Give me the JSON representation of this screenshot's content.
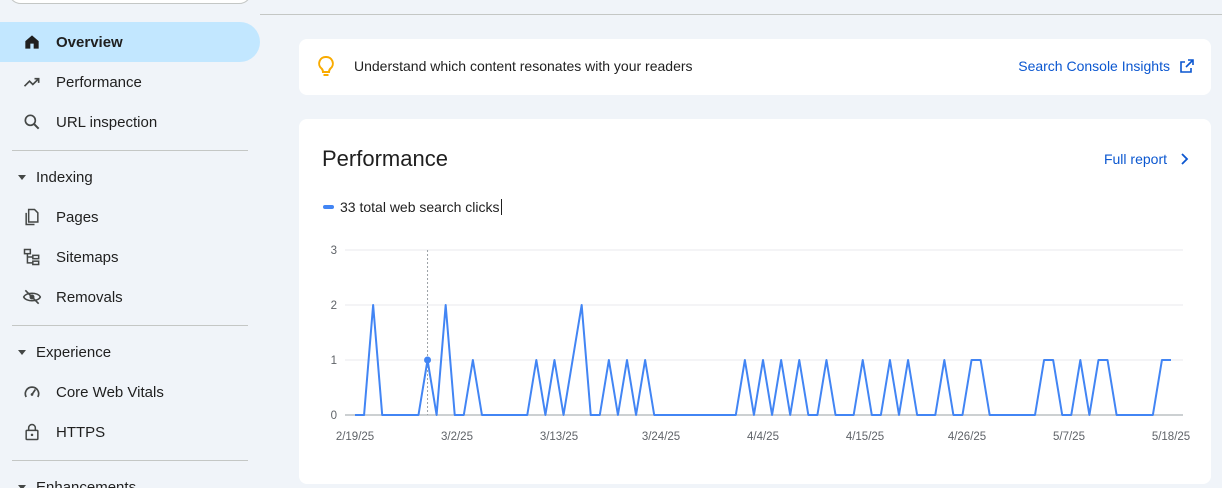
{
  "sidebar": {
    "items": [
      {
        "label": "Overview",
        "icon": "home-icon",
        "active": true
      },
      {
        "label": "Performance",
        "icon": "trending-up-icon"
      },
      {
        "label": "URL inspection",
        "icon": "search-icon"
      }
    ],
    "sections": [
      {
        "label": "Indexing",
        "items": [
          {
            "label": "Pages",
            "icon": "pages-icon"
          },
          {
            "label": "Sitemaps",
            "icon": "sitemap-icon"
          },
          {
            "label": "Removals",
            "icon": "eye-off-icon"
          }
        ]
      },
      {
        "label": "Experience",
        "items": [
          {
            "label": "Core Web Vitals",
            "icon": "speed-icon"
          },
          {
            "label": "HTTPS",
            "icon": "lock-icon"
          }
        ]
      },
      {
        "label": "Enhancements",
        "items": []
      }
    ]
  },
  "insights": {
    "text": "Understand which content resonates with your readers",
    "link_label": "Search Console Insights",
    "icon": "lightbulb-icon",
    "link_icon": "open-in-new-icon"
  },
  "performance": {
    "title": "Performance",
    "full_report_label": "Full report",
    "legend_label": "33 total web search clicks"
  },
  "colors": {
    "accent": "#0b57d0",
    "active_nav": "#c2e7ff",
    "series": "#4285f4",
    "bulb": "#f9ab00"
  },
  "chart_data": {
    "type": "line",
    "series": [
      {
        "name": "33 total web search clicks",
        "values": [
          0,
          0,
          2,
          0,
          0,
          0,
          0,
          0,
          1,
          0,
          2,
          0,
          0,
          1,
          0,
          0,
          0,
          0,
          0,
          0,
          1,
          0,
          1,
          0,
          1,
          2,
          0,
          0,
          1,
          0,
          1,
          0,
          1,
          0,
          0,
          0,
          0,
          0,
          0,
          0,
          0,
          0,
          0,
          1,
          0,
          1,
          0,
          1,
          0,
          1,
          0,
          0,
          1,
          0,
          0,
          0,
          1,
          0,
          0,
          1,
          0,
          1,
          0,
          0,
          0,
          1,
          0,
          0,
          1,
          1,
          0,
          0,
          0,
          0,
          0,
          0,
          1,
          1,
          0,
          0,
          1,
          0,
          1,
          1,
          0,
          0,
          0,
          0,
          0,
          1,
          1
        ]
      }
    ],
    "x_start": "2/19/25",
    "x_end": "5/18/25",
    "x_ticks": [
      "2/19/25",
      "3/2/25",
      "3/13/25",
      "3/24/25",
      "4/4/25",
      "4/15/25",
      "4/26/25",
      "5/7/25",
      "5/18/25"
    ],
    "y_ticks": [
      "0",
      "1",
      "2",
      "3"
    ],
    "ylim": [
      0,
      3
    ],
    "hover_date": "2/27/25",
    "grid": true
  }
}
